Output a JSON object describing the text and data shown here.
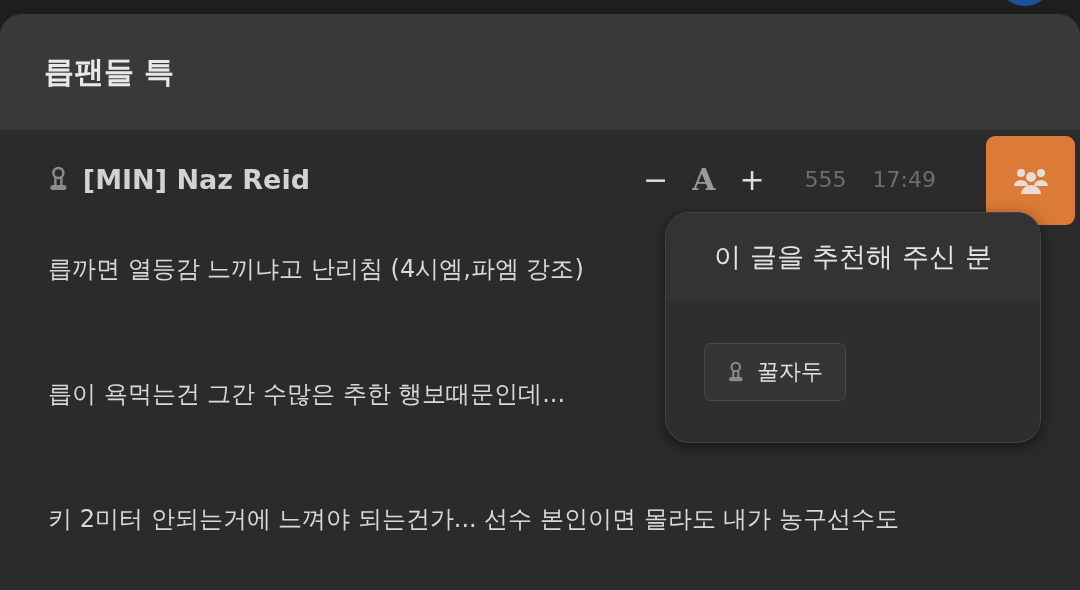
{
  "post": {
    "title": "릅팬들 특",
    "author": "[MIN] Naz Reid",
    "font_controls": [
      "−",
      "A",
      "+"
    ],
    "views": "555",
    "time": "17:49",
    "paragraphs": [
      "릅까면 열등감 느끼냐고 난리침 (4시엠,파엠 강조)",
      "릅이 욕먹는건 그간 수많은 추한 행보때문인데...",
      "키 2미터 안되는거에 느껴야 되는건가... 선수 본인이면 몰라도 내가 농구선수도"
    ]
  },
  "recommend_popup": {
    "title": "이 글을 추천해 주신 분",
    "users": [
      "꿀자두"
    ]
  }
}
